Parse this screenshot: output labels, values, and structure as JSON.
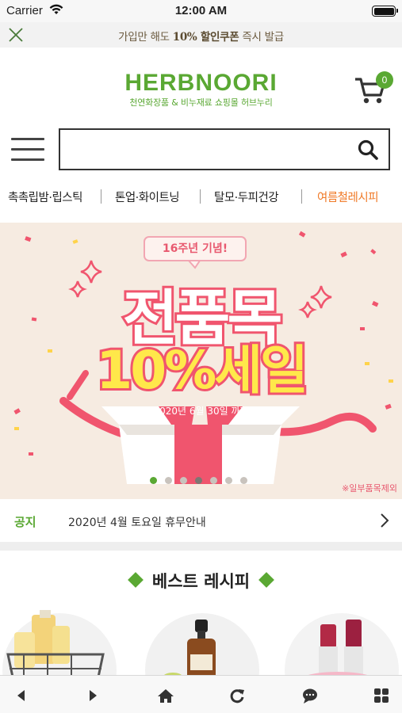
{
  "status": {
    "carrier": "Carrier",
    "time": "12:00 AM"
  },
  "promo": {
    "prefix": "가입만 해도 ",
    "highlight": "10% 할인쿠폰",
    "suffix": " 즉시 발급"
  },
  "header": {
    "logo_text": "HERBNOORI",
    "logo_sub": "천연화장품 & 비누재료 쇼핑몰 허브누리",
    "cart_count": "0"
  },
  "search": {
    "placeholder": "",
    "value": ""
  },
  "categories": [
    "촉촉립밤·립스틱",
    "톤업·화이트닝",
    "탈모·두피건강",
    "여름철레시피"
  ],
  "banner": {
    "badge": "16주년 기념!",
    "title": "전품목",
    "subtitle": "10%세일",
    "date": "2020년 6월 30일 까지",
    "note": "※일부품목제외",
    "slide_count": 7,
    "active_slide": 1
  },
  "notice": {
    "label": "공지",
    "text": "2020년 4월 토요일 휴무안내"
  },
  "best": {
    "title": "베스트 레시피"
  },
  "colors": {
    "brand_green": "#5aa833",
    "accent_orange": "#f07a28",
    "banner_pink": "#f0556e",
    "banner_yellow": "#ffe84a"
  },
  "toolbar": {
    "icons": [
      "back-icon",
      "forward-icon",
      "home-icon",
      "refresh-icon",
      "chat-icon",
      "grid-menu-icon"
    ]
  }
}
